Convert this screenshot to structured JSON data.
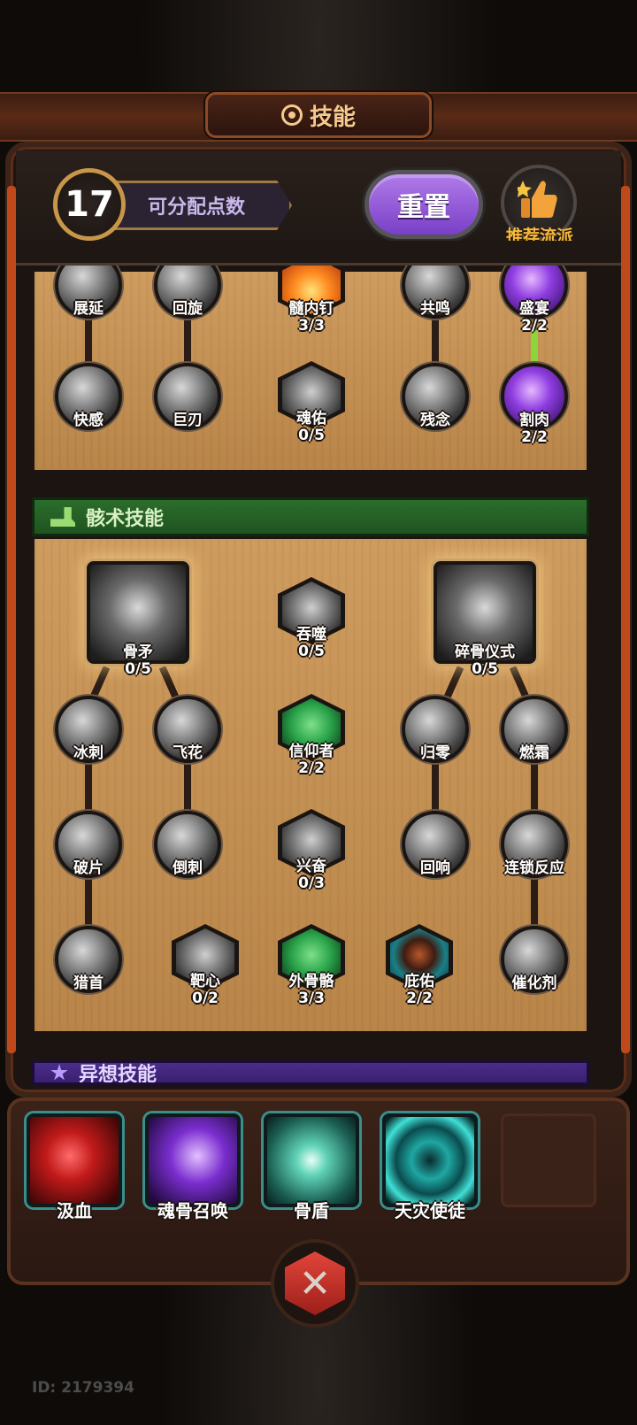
{
  "header": {
    "title": "技能"
  },
  "topbar": {
    "points_value": "17",
    "points_label": "可分配点数",
    "reset_label": "重置",
    "recommend_label": "推荐流派"
  },
  "tree1": {
    "row1": [
      {
        "name": "展延"
      },
      {
        "name": "回旋"
      },
      {
        "name": "髓内钉",
        "level": "3/3"
      },
      {
        "name": "共鸣"
      },
      {
        "name": "盛宴",
        "level": "2/2"
      }
    ],
    "row2": [
      {
        "name": "快感"
      },
      {
        "name": "巨刃"
      },
      {
        "name": "魂佑",
        "level": "0/5"
      },
      {
        "name": "残念"
      },
      {
        "name": "割肉",
        "level": "2/2"
      }
    ]
  },
  "section_bone": {
    "title": "骸术技能",
    "tops": [
      {
        "name": "骨矛",
        "level": "0/5"
      },
      {
        "name": "吞噬",
        "level": "0/5"
      },
      {
        "name": "碎骨仪式",
        "level": "0/5"
      }
    ],
    "row1": [
      {
        "name": "冰刺"
      },
      {
        "name": "飞花"
      },
      {
        "name": "信仰者",
        "level": "2/2"
      },
      {
        "name": "归零"
      },
      {
        "name": "燃霜"
      }
    ],
    "row2": [
      {
        "name": "破片"
      },
      {
        "name": "倒刺"
      },
      {
        "name": "兴奋",
        "level": "0/3"
      },
      {
        "name": "回响"
      },
      {
        "name": "连锁反应"
      }
    ],
    "row3": [
      {
        "name": "猎首"
      },
      {
        "name": "靶心",
        "level": "0/2"
      },
      {
        "name": "外骨骼",
        "level": "3/3"
      },
      {
        "name": "庇佑",
        "level": "2/2"
      },
      {
        "name": "催化剂"
      }
    ]
  },
  "section_other": {
    "title": "异想技能"
  },
  "equipped": [
    {
      "name": "汲血",
      "color": "#c21a1a"
    },
    {
      "name": "魂骨召唤",
      "color": "#7a2ecf"
    },
    {
      "name": "骨盾",
      "color": "#2f9a86"
    },
    {
      "name": "天灾使徒",
      "color": "#1fa7a2"
    }
  ],
  "footer": {
    "id_text": "ID: 2179394"
  },
  "colors": {
    "accent_gold": "#f6c98d",
    "reset_purple": "#9b5de5",
    "active_green": "#8bd63b"
  }
}
